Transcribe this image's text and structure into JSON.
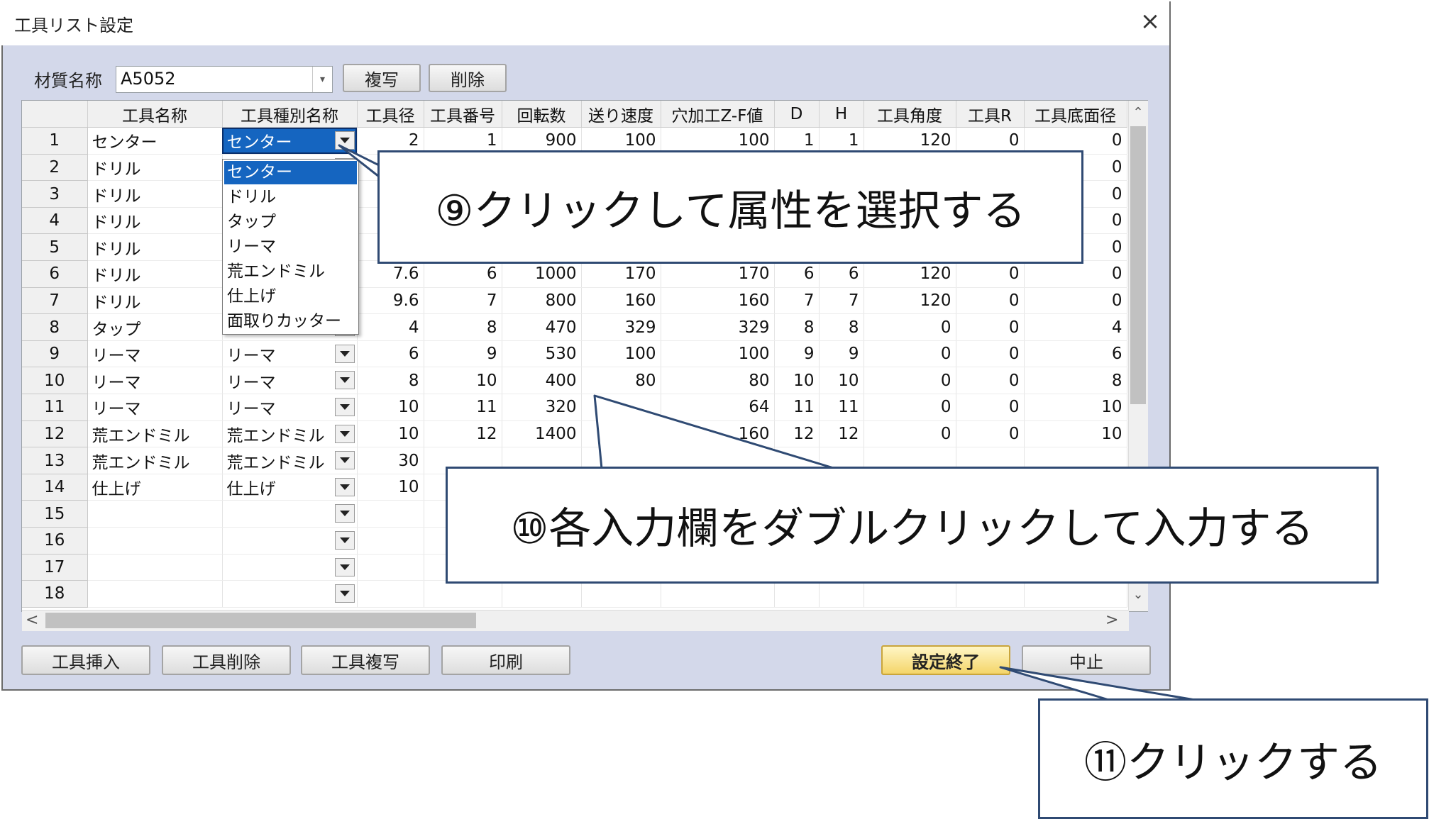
{
  "dialog": {
    "title": "工具リスト設定",
    "close_icon": "×",
    "material_label": "材質名称",
    "material_value": "A5052",
    "copy_button": "複写",
    "delete_button": "削除"
  },
  "grid": {
    "columns": [
      "",
      "工具名称",
      "工具種別名称",
      "工具径",
      "工具番号",
      "回転数",
      "送り速度",
      "穴加工Z-F値",
      "D",
      "H",
      "工具角度",
      "工具R",
      "工具底面径"
    ],
    "rows": [
      [
        "1",
        "センター",
        "センター",
        "2",
        "1",
        "900",
        "100",
        "100",
        "1",
        "1",
        "120",
        "0",
        "0"
      ],
      [
        "2",
        "ドリル",
        "",
        "",
        "",
        "",
        "",
        "",
        "",
        "",
        "",
        "",
        "0"
      ],
      [
        "3",
        "ドリル",
        "",
        "",
        "",
        "",
        "",
        "",
        "",
        "",
        "",
        "",
        "0"
      ],
      [
        "4",
        "ドリル",
        "",
        "",
        "",
        "",
        "",
        "",
        "",
        "",
        "",
        "",
        "0"
      ],
      [
        "5",
        "ドリル",
        "",
        "",
        "",
        "",
        "",
        "",
        "",
        "",
        "",
        "",
        "0"
      ],
      [
        "6",
        "ドリル",
        "",
        "7.6",
        "6",
        "1000",
        "170",
        "170",
        "6",
        "6",
        "120",
        "0",
        "0"
      ],
      [
        "7",
        "ドリル",
        "",
        "9.6",
        "7",
        "800",
        "160",
        "160",
        "7",
        "7",
        "120",
        "0",
        "0"
      ],
      [
        "8",
        "タップ",
        "",
        "4",
        "8",
        "470",
        "329",
        "329",
        "8",
        "8",
        "0",
        "0",
        "4"
      ],
      [
        "9",
        "リーマ",
        "リーマ",
        "6",
        "9",
        "530",
        "100",
        "100",
        "9",
        "9",
        "0",
        "0",
        "6"
      ],
      [
        "10",
        "リーマ",
        "リーマ",
        "8",
        "10",
        "400",
        "80",
        "80",
        "10",
        "10",
        "0",
        "0",
        "8"
      ],
      [
        "11",
        "リーマ",
        "リーマ",
        "10",
        "11",
        "320",
        "",
        "64",
        "11",
        "11",
        "0",
        "0",
        "10"
      ],
      [
        "12",
        "荒エンドミル",
        "荒エンドミル",
        "10",
        "12",
        "1400",
        "",
        "160",
        "12",
        "12",
        "0",
        "0",
        "10"
      ],
      [
        "13",
        "荒エンドミル",
        "荒エンドミル",
        "30",
        "",
        "",
        "",
        "",
        "",
        "",
        "",
        "",
        ""
      ],
      [
        "14",
        "仕上げ",
        "仕上げ",
        "10",
        "",
        "",
        "",
        "",
        "",
        "",
        "",
        "",
        ""
      ],
      [
        "15",
        "",
        "",
        "",
        "",
        "",
        "",
        "",
        "",
        "",
        "",
        "",
        ""
      ],
      [
        "16",
        "",
        "",
        "",
        "",
        "",
        "",
        "",
        "",
        "",
        "",
        "",
        ""
      ],
      [
        "17",
        "",
        "",
        "",
        "",
        "",
        "",
        "",
        "",
        "",
        "",
        "",
        ""
      ],
      [
        "18",
        "",
        "",
        "",
        "",
        "",
        "",
        "",
        "",
        "",
        "",
        "",
        ""
      ]
    ],
    "type_dropdown_rows": [
      "1",
      "2",
      "3",
      "4",
      "5",
      "6",
      "7",
      "8",
      "9",
      "10",
      "11",
      "12",
      "13",
      "14",
      "15",
      "16",
      "17",
      "18"
    ],
    "dropdown_options": [
      "センター",
      "ドリル",
      "タップ",
      "リーマ",
      "荒エンドミル",
      "仕上げ",
      "面取りカッター"
    ],
    "dropdown_selected": "センター"
  },
  "footer": {
    "insert_tool": "工具挿入",
    "delete_tool": "工具削除",
    "copy_tool": "工具複写",
    "print": "印刷",
    "finish": "設定終了",
    "cancel": "中止"
  },
  "callouts": {
    "step9": "⑨クリックして属性を選択する",
    "step10": "⑩各入力欄をダブルクリックして入力する",
    "step11": "⑪クリックする"
  },
  "colors": {
    "dialog_bg": "#d3d8ea",
    "selection_blue": "#1565c0",
    "callout_border": "#2f4a73",
    "finish_button": "#f4d56a"
  }
}
